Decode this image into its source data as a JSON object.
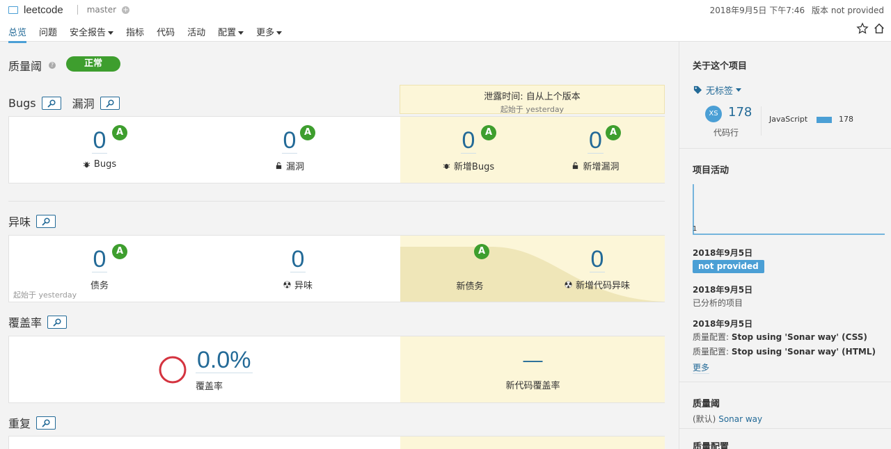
{
  "header": {
    "project_name": "leetcode",
    "branch": "master",
    "analysis_date": "2018年9月5日 下午7:46",
    "version": "版本 not provided"
  },
  "nav": {
    "tabs": [
      {
        "label": "总览",
        "active": true,
        "dropdown": false
      },
      {
        "label": "问题",
        "active": false,
        "dropdown": false
      },
      {
        "label": "安全报告",
        "active": false,
        "dropdown": true
      },
      {
        "label": "指标",
        "active": false,
        "dropdown": false
      },
      {
        "label": "代码",
        "active": false,
        "dropdown": false
      },
      {
        "label": "活动",
        "active": false,
        "dropdown": false
      },
      {
        "label": "配置",
        "active": false,
        "dropdown": true
      },
      {
        "label": "更多",
        "active": false,
        "dropdown": true
      }
    ]
  },
  "quality_gate": {
    "title": "质量阈",
    "status": "正常"
  },
  "leak_period": {
    "title": "泄露时间: 自从上个版本",
    "since": "起始于 yesterday"
  },
  "bugs_section": {
    "title_bugs": "Bugs",
    "title_vuln": "漏洞",
    "bugs": {
      "value": "0",
      "rating": "A",
      "label": "Bugs"
    },
    "vulnerabilities": {
      "value": "0",
      "rating": "A",
      "label": "漏洞"
    },
    "new_bugs": {
      "value": "0",
      "rating": "A",
      "label": "新增Bugs"
    },
    "new_vulnerabilities": {
      "value": "0",
      "rating": "A",
      "label": "新增漏洞"
    }
  },
  "smells_section": {
    "title": "异味",
    "debt": {
      "value": "0",
      "rating": "A",
      "label": "债务"
    },
    "smells": {
      "value": "0",
      "label": "异味"
    },
    "new_debt": {
      "rating": "A",
      "label": "新债务"
    },
    "new_smells": {
      "value": "0",
      "label": "新增代码异味"
    },
    "since": "起始于 yesterday"
  },
  "coverage_section": {
    "title": "覆盖率",
    "coverage": {
      "value": "0.0%",
      "label": "覆盖率"
    },
    "new_coverage": {
      "value": "—",
      "label": "新代码覆盖率"
    }
  },
  "duplications_section": {
    "title": "重复"
  },
  "sidebar": {
    "about_title": "关于这个项目",
    "tags_label": "无标签",
    "avatar_text": "XS",
    "lines_of_code": "178",
    "lines_label": "代码行",
    "language": "JavaScript",
    "language_lines": "178",
    "activity_title": "项目活动",
    "activity_chart_value": "1",
    "activity": [
      {
        "date": "2018年9月5日",
        "badge": "not provided"
      },
      {
        "date": "2018年9月5日",
        "text": "已分析的项目"
      },
      {
        "date": "2018年9月5日",
        "lines": [
          {
            "prefix": "质量配置:",
            "text": "Stop using 'Sonar way' (CSS)"
          },
          {
            "prefix": "质量配置:",
            "text": "Stop using 'Sonar way' (HTML)"
          }
        ]
      }
    ],
    "more_link": "更多",
    "quality_gate_title": "质量阈",
    "qg_default": "(默认)",
    "qg_name": "Sonar way",
    "quality_profiles_title": "质量配置"
  },
  "colors": {
    "accent": "#4b9fd5",
    "link": "#236a97",
    "success": "#3e9e2e",
    "leak": "#fcf6d8"
  }
}
